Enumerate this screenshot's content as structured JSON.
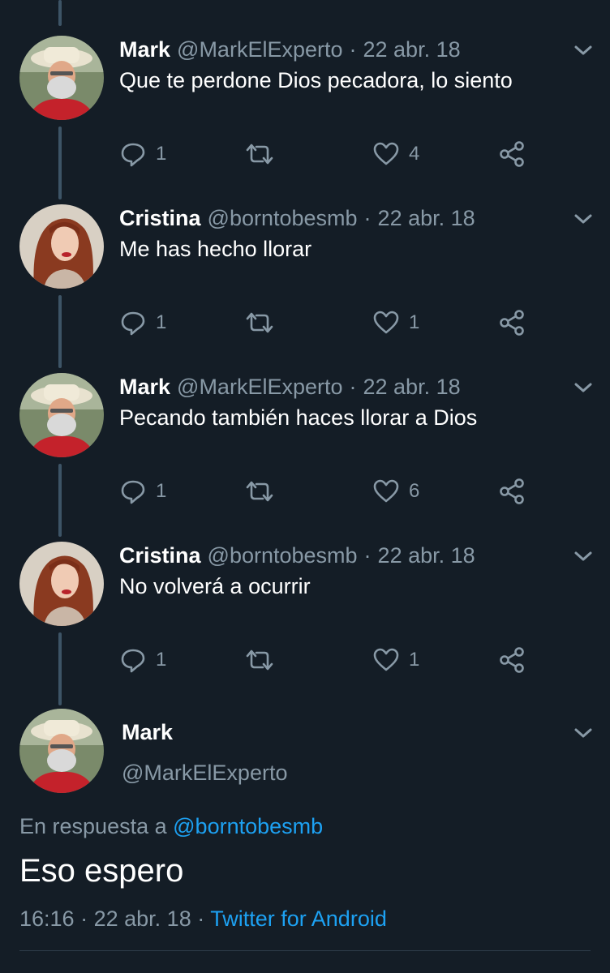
{
  "tweets": [
    {
      "name": "Mark",
      "handle": "@MarkElExperto",
      "separator": "·",
      "date": "22 abr. 18",
      "text": "Que te perdone Dios pecadora, lo siento",
      "replies": "1",
      "likes": "4"
    },
    {
      "name": "Cristina",
      "handle": "@borntobesmb",
      "separator": "·",
      "date": "22 abr. 18",
      "text": "Me has hecho llorar",
      "replies": "1",
      "likes": "1"
    },
    {
      "name": "Mark",
      "handle": "@MarkElExperto",
      "separator": "·",
      "date": "22 abr. 18",
      "text": "Pecando también haces llorar a Dios",
      "replies": "1",
      "likes": "6"
    },
    {
      "name": "Cristina",
      "handle": "@borntobesmb",
      "separator": "·",
      "date": "22 abr. 18",
      "text": "No volverá a ocurrir",
      "replies": "1",
      "likes": "1"
    }
  ],
  "main_tweet": {
    "name": "Mark",
    "handle": "@MarkElExperto",
    "reply_prefix": "En respuesta a",
    "reply_handle": "@borntobesmb",
    "text": "Eso espero",
    "time": "16:16",
    "separator": "·",
    "date": "22 abr. 18",
    "source": "Twitter for Android"
  },
  "icons": {
    "reply": "reply-icon",
    "retweet": "retweet-icon",
    "like": "heart-icon",
    "share": "share-icon",
    "menu": "chevron-down-icon"
  },
  "colors": {
    "background": "#141d26",
    "secondary_text": "#8899a6",
    "link": "#1da1f2",
    "thread_line": "#3d5466"
  }
}
